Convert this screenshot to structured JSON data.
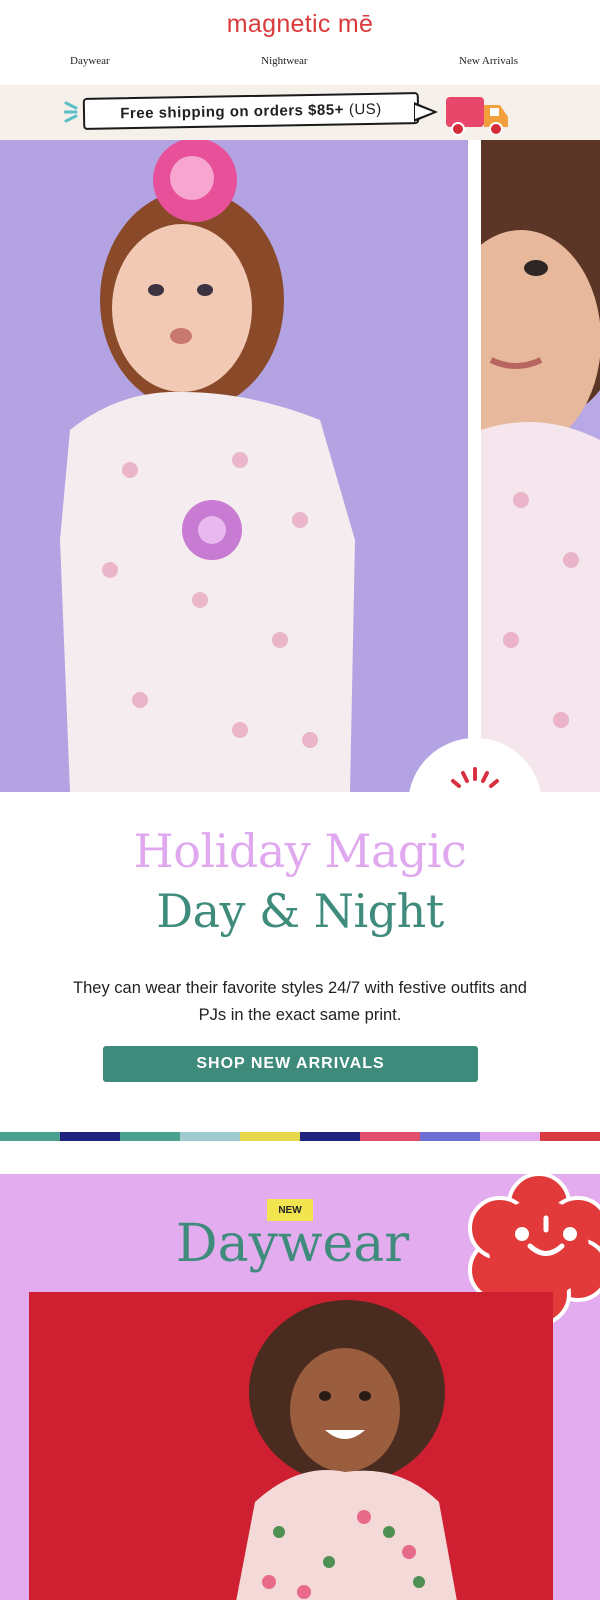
{
  "brand": {
    "logo_text": "magnetic mē",
    "accent": "#d93a3a",
    "badge_mark": "m"
  },
  "nav": {
    "items": [
      {
        "label": "Daywear"
      },
      {
        "label": "Nightwear"
      },
      {
        "label": "New Arrivals"
      }
    ]
  },
  "shipping": {
    "message": "Free shipping on orders $85+",
    "region": "(US)",
    "icon": "delivery-truck-icon"
  },
  "hero": {
    "left_bg": "#b3a3e2",
    "right_bg": "#b8a8e6"
  },
  "headline": {
    "line1": "Holiday Magic",
    "line2": "Day & Night",
    "body": "They can wear their favorite styles 24/7 with festive outfits and PJs in the exact same print.",
    "cta_label": "SHOP NEW ARRIVALS",
    "line1_color": "#e0a9ef",
    "line2_color": "#3f8c7c"
  },
  "stripe_colors": [
    "#4aa28f",
    "#1f237f",
    "#4aa28f",
    "#9fcbd0",
    "#e5d84b",
    "#1f237f",
    "#e0506a",
    "#6e6fd4",
    "#e2acee",
    "#d83a42"
  ],
  "daywear": {
    "badge": "NEW",
    "title": "Daywear",
    "bg": "#e2acee",
    "photo_bg": "#cf2032",
    "icon": "smiley-flower-icon"
  }
}
